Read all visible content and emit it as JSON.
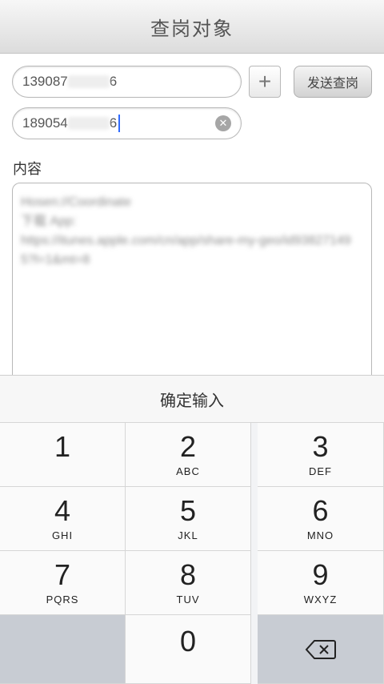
{
  "navbar": {
    "title": "查岗对象"
  },
  "phones": [
    {
      "prefix": "139087",
      "suffix": "6"
    },
    {
      "prefix": "189054",
      "suffix": "6"
    }
  ],
  "buttons": {
    "add": "+",
    "send": "发送查岗"
  },
  "content": {
    "label": "内容",
    "text": "Hosen://Coordinate\n下载 App:\nhttps://itunes.apple.com/cn/app/share-my-geo/id938271495?l=1&mt=8"
  },
  "keyboard": {
    "confirm": "确定输入",
    "keys": [
      {
        "num": "1",
        "letters": ""
      },
      {
        "num": "2",
        "letters": "ABC"
      },
      {
        "num": "3",
        "letters": "DEF"
      },
      {
        "num": "4",
        "letters": "GHI"
      },
      {
        "num": "5",
        "letters": "JKL"
      },
      {
        "num": "6",
        "letters": "MNO"
      },
      {
        "num": "7",
        "letters": "PQRS"
      },
      {
        "num": "8",
        "letters": "TUV"
      },
      {
        "num": "9",
        "letters": "WXYZ"
      },
      {
        "num": "0",
        "letters": ""
      }
    ],
    "delete_icon": "backspace-icon"
  }
}
